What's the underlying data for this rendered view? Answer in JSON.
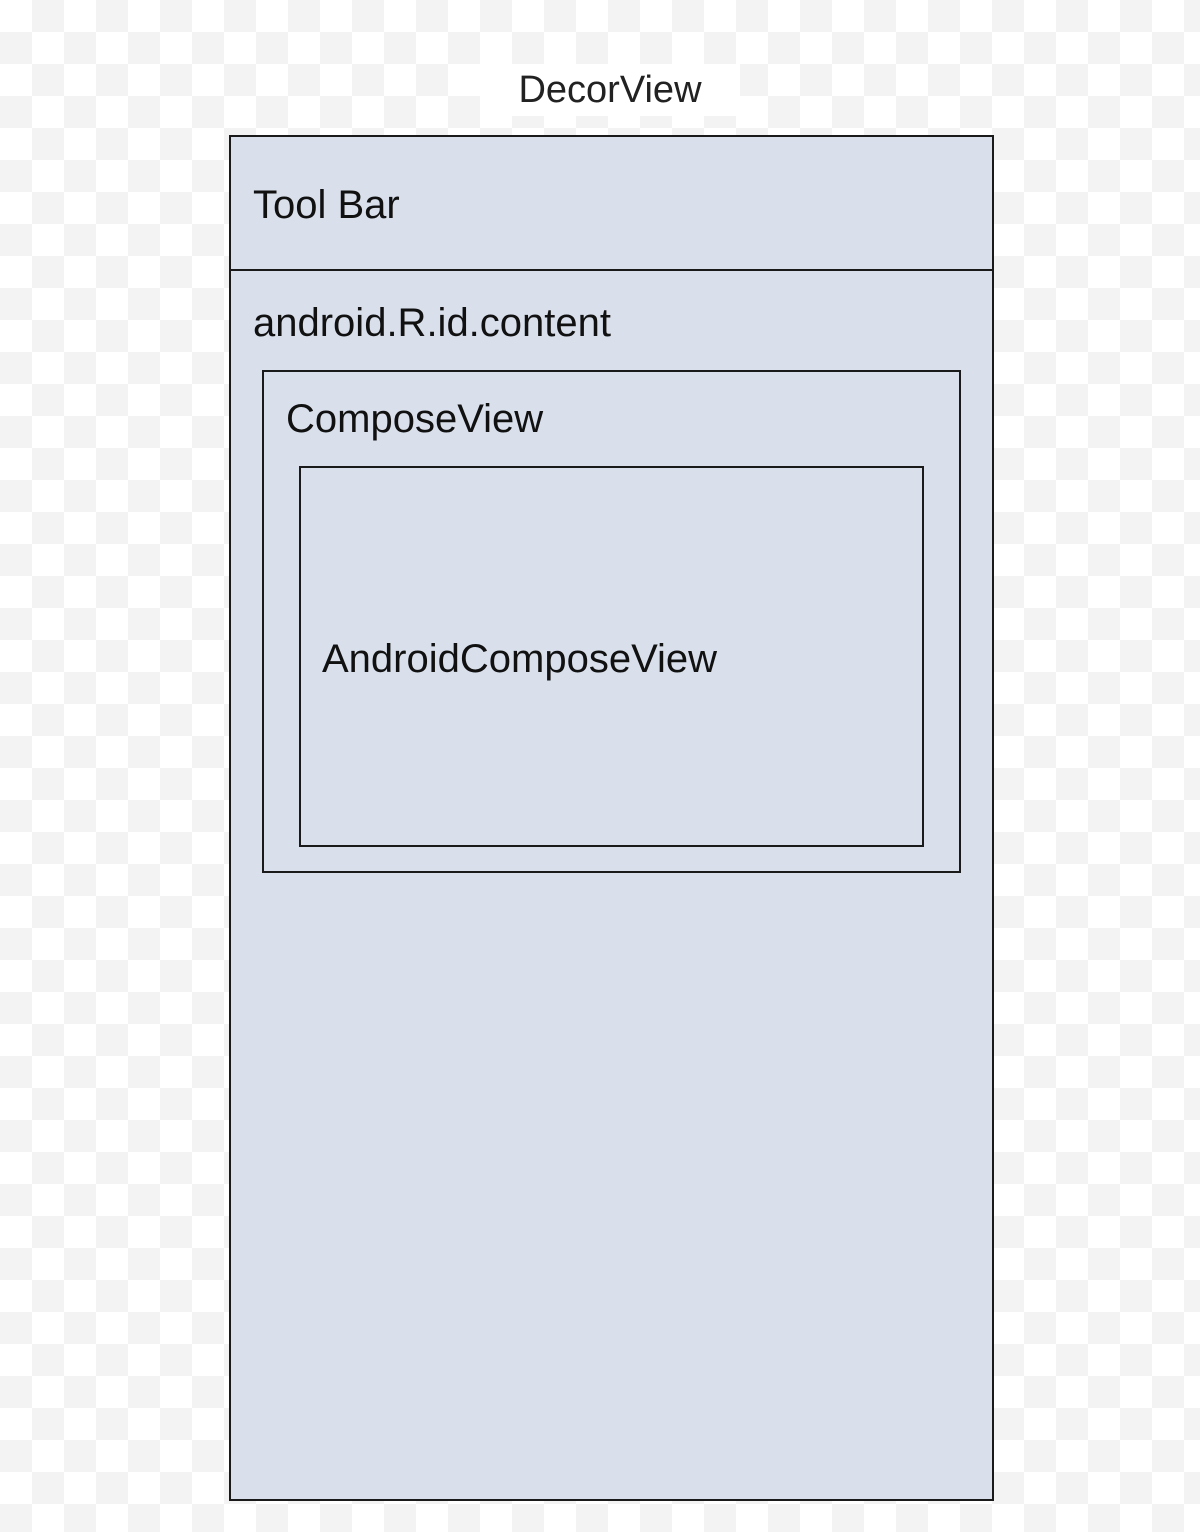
{
  "diagram": {
    "title": "DecorView",
    "toolbar_label": "Tool Bar",
    "content_label": "android.R.id.content",
    "compose_view_label": "ComposeView",
    "android_compose_view_label": "AndroidComposeView",
    "colors": {
      "box_fill": "#d9e0ec",
      "border": "#1a1a1a"
    }
  }
}
